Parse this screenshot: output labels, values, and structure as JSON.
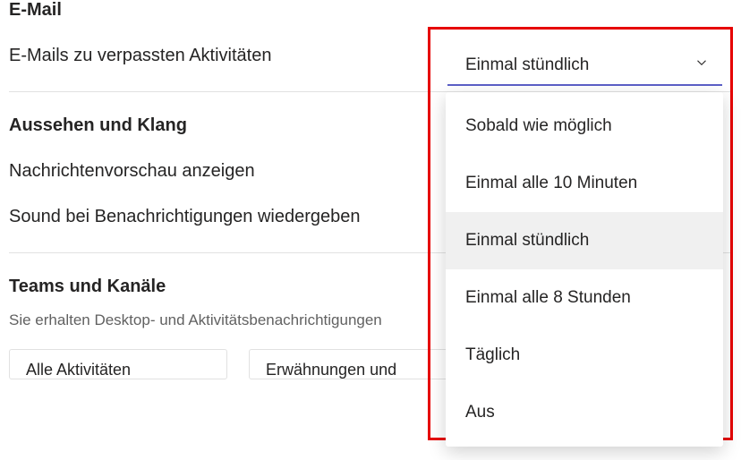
{
  "sections": {
    "email": {
      "heading": "E-Mail",
      "row_label": "E-Mails zu verpassten Aktivitäten"
    },
    "appearance": {
      "heading": "Aussehen und Klang",
      "preview_label": "Nachrichtenvorschau anzeigen",
      "sound_label": "Sound bei Benachrichtigungen wiedergeben"
    },
    "teams": {
      "heading": "Teams und Kanäle",
      "subtext": "Sie erhalten Desktop- und Aktivitätsbenachrichtigungen",
      "card1": "Alle Aktivitäten",
      "card2": "Erwähnungen und"
    }
  },
  "dropdown": {
    "selected": "Einmal stündlich",
    "options": [
      "Sobald wie möglich",
      "Einmal alle 10 Minuten",
      "Einmal stündlich",
      "Einmal alle 8 Stunden",
      "Täglich",
      "Aus"
    ],
    "selected_index": 2
  }
}
